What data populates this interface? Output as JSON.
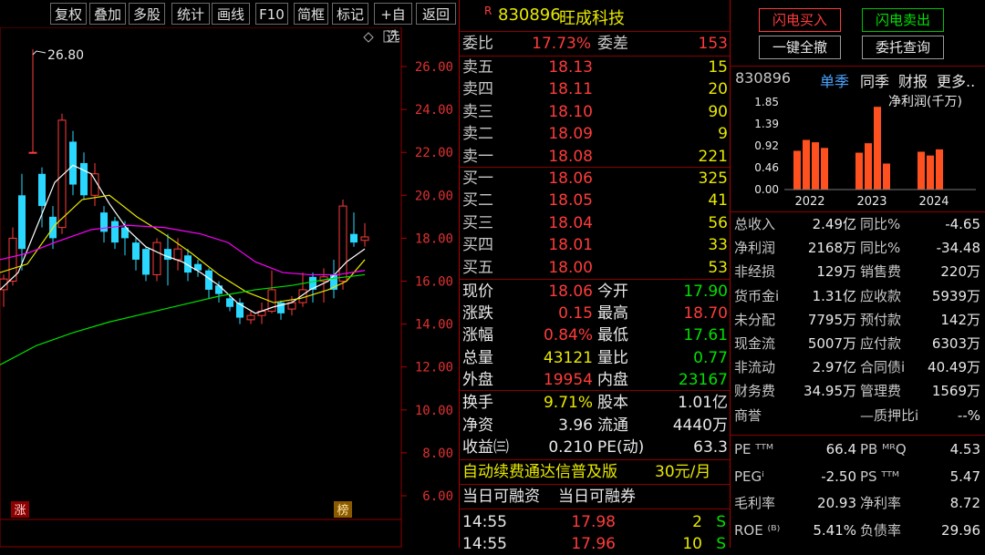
{
  "toolbar": {
    "items": [
      "复权",
      "叠加",
      "多股",
      "统计",
      "画线",
      "F10",
      "简框",
      "标记",
      "+自选",
      "返回"
    ]
  },
  "chart": {
    "high_label": "26.80",
    "price_axis": [
      "26.00",
      "24.00",
      "22.00",
      "20.00",
      "18.00",
      "16.00",
      "14.00",
      "12.00",
      "10.00",
      "8.00",
      "6.00"
    ],
    "marker_left": "涨",
    "marker_right": "榜"
  },
  "stock": {
    "tag": "R",
    "code": "830896",
    "name": "旺成科技"
  },
  "commission": {
    "ratio_label": "委比",
    "ratio": "17.73%",
    "diff_label": "委差",
    "diff": "153"
  },
  "sell": [
    {
      "label": "卖五",
      "price": "18.13",
      "vol": "15"
    },
    {
      "label": "卖四",
      "price": "18.11",
      "vol": "20"
    },
    {
      "label": "卖三",
      "price": "18.10",
      "vol": "90"
    },
    {
      "label": "卖二",
      "price": "18.09",
      "vol": "9"
    },
    {
      "label": "卖一",
      "price": "18.08",
      "vol": "221"
    }
  ],
  "buy": [
    {
      "label": "买一",
      "price": "18.06",
      "vol": "325"
    },
    {
      "label": "买二",
      "price": "18.05",
      "vol": "41"
    },
    {
      "label": "买三",
      "price": "18.04",
      "vol": "56"
    },
    {
      "label": "买四",
      "price": "18.01",
      "vol": "33"
    },
    {
      "label": "买五",
      "price": "18.00",
      "vol": "53"
    }
  ],
  "quote": {
    "price_label": "现价",
    "price": "18.06",
    "open_label": "今开",
    "open": "17.90",
    "change_label": "涨跌",
    "change": "0.15",
    "high_label": "最高",
    "high": "18.70",
    "pct_label": "涨幅",
    "pct": "0.84%",
    "low_label": "最低",
    "low": "17.61",
    "vol_label": "总量",
    "vol": "43121",
    "vr_label": "量比",
    "vr": "0.77",
    "outer_label": "外盘",
    "outer": "19954",
    "inner_label": "内盘",
    "inner": "23167",
    "turnover_label": "换手",
    "turnover": "9.71%",
    "shares_label": "股本",
    "shares": "1.01亿",
    "nav_label": "净资",
    "nav": "3.96",
    "float_label": "流通",
    "float": "4440万",
    "eps_label": "收益㈢",
    "eps": "0.210",
    "pe_label": "PE(动)",
    "pe": "63.3"
  },
  "promo": {
    "text": "自动续费通达信普及版",
    "price": "30元/月"
  },
  "margin": {
    "a": "当日可融资",
    "b": "当日可融券"
  },
  "ticks": [
    {
      "time": "14:55",
      "price": "17.98",
      "vol": "2",
      "flag": "S"
    },
    {
      "time": "14:55",
      "price": "17.96",
      "vol": "10",
      "flag": "S"
    }
  ],
  "actions": {
    "flash_buy": "闪电买入",
    "flash_sell": "闪电卖出",
    "cancel_all": "一键全撤",
    "query": "委托查询"
  },
  "fin_tabs": {
    "code": "830896",
    "tabs": [
      "单季",
      "同季",
      "财报",
      "更多.."
    ]
  },
  "profit_chart": {
    "title": "净利润(千万)",
    "y_ticks": [
      "1.85",
      "1.39",
      "0.92",
      "0.46",
      "0.00"
    ],
    "years": [
      "2022",
      "2023",
      "2024"
    ]
  },
  "chart_data": {
    "type": "bar",
    "title": "净利润(千万)",
    "categories": [
      "2022Q1",
      "2022Q2",
      "2022Q3",
      "2022Q4",
      "2023Q1",
      "2023Q2",
      "2023Q3",
      "2023Q4",
      "2024Q1",
      "2024Q2",
      "2024Q3"
    ],
    "values": [
      0.82,
      1.05,
      1.0,
      0.88,
      0.78,
      0.98,
      1.75,
      0.55,
      0.8,
      0.72,
      0.85
    ],
    "ylim": [
      0,
      1.85
    ]
  },
  "fin": [
    {
      "l": "总收入",
      "v": "2.49亿",
      "l2": "同比%",
      "v2": "-4.65"
    },
    {
      "l": "净利润",
      "v": "2168万",
      "l2": "同比%",
      "v2": "-34.48"
    },
    {
      "l": "非经损",
      "v": "129万",
      "l2": "销售费",
      "v2": "220万"
    },
    {
      "l": "货币金i",
      "v": "1.31亿",
      "l2": "应收款",
      "v2": "5939万"
    },
    {
      "l": "未分配",
      "v": "7795万",
      "l2": "预付款",
      "v2": "142万"
    },
    {
      "l": "现金流",
      "v": "5007万",
      "l2": "应付款",
      "v2": "6303万"
    },
    {
      "l": "非流动",
      "v": "2.97亿",
      "l2": "合同债i",
      "v2": "40.49万"
    },
    {
      "l": "财务费",
      "v": "34.95万",
      "l2": "管理费",
      "v2": "1569万"
    },
    {
      "l": "商誉",
      "v": "",
      "l2": "—质押比i",
      "v2": "--%"
    }
  ],
  "valuation": [
    {
      "l": "PE ᵀᵀᴹ",
      "v": "66.4",
      "l2": "PB ᴹᴿQ",
      "v2": "4.53"
    },
    {
      "l": "PEGⁱ",
      "v": "-2.50",
      "l2": "PS ᵀᵀᴹ",
      "v2": "5.47"
    },
    {
      "l": "毛利率",
      "v": "20.93",
      "l2": "净利率",
      "v2": "8.72"
    },
    {
      "l": "ROE ⁽ᴮ⁾",
      "v": "5.41%",
      "l2": "负债率",
      "v2": "29.96"
    }
  ]
}
